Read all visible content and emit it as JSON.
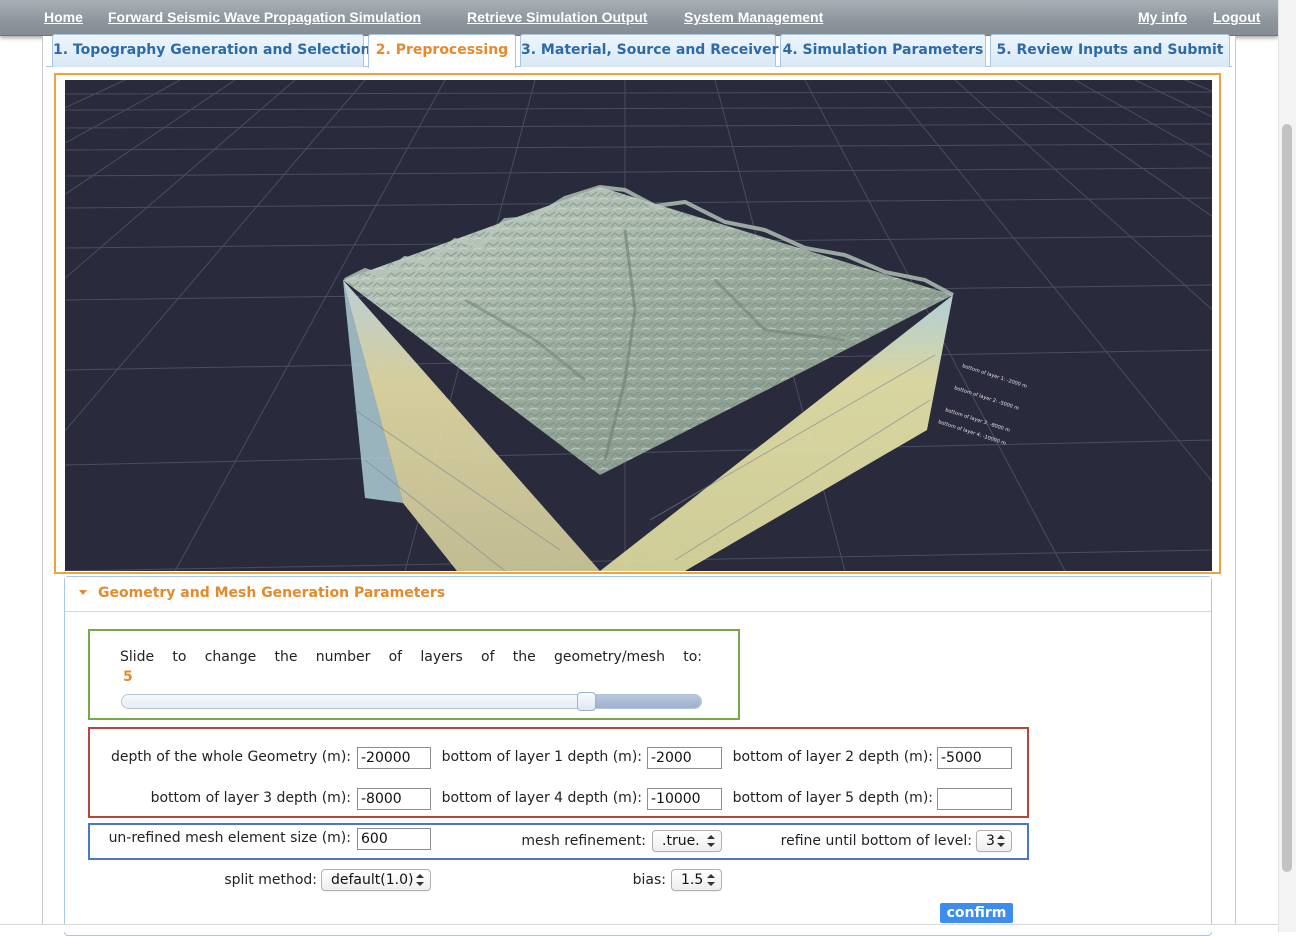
{
  "nav": {
    "home": "Home",
    "forward": "Forward Seismic Wave Propagation Simulation",
    "retrieve": "Retrieve Simulation Output",
    "system": "System Management",
    "myinfo": "My info",
    "logout": "Logout"
  },
  "tabs": [
    {
      "label": "1. Topography Generation and Selection"
    },
    {
      "label": "2. Preprocessing",
      "active": true
    },
    {
      "label": "3. Material, Source and Receiver"
    },
    {
      "label": "4. Simulation Parameters"
    },
    {
      "label": "5. Review Inputs and Submit"
    }
  ],
  "viewer": {
    "background": "#292b3c",
    "annotations": [
      "bottom of layer 1: -2000 m",
      "bottom of layer 2: -5000 m",
      "bottom of layer 3: -8000 m",
      "bottom of layer 4: -10000 m"
    ]
  },
  "accordion": {
    "title": "Geometry and Mesh Generation Parameters"
  },
  "slider": {
    "text": "Slide to change the number of layers of the geometry/mesh to:",
    "value": "5",
    "fraction": 0.8
  },
  "depth": {
    "whole_label": "depth of the whole Geometry (m):",
    "whole_value": "-20000",
    "layer1_label": "bottom of layer 1 depth (m):",
    "layer1_value": "-2000",
    "layer2_label": "bottom of layer 2 depth (m):",
    "layer2_value": "-5000",
    "layer3_label": "bottom of layer 3 depth (m):",
    "layer3_value": "-8000",
    "layer4_label": "bottom of layer 4 depth (m):",
    "layer4_value": "-10000",
    "layer5_label": "bottom of layer 5 depth (m):",
    "layer5_value": ""
  },
  "mesh": {
    "size_label": "un-refined mesh element size (m):",
    "size_value": "600",
    "refine_label": "mesh refinement:",
    "refine_value": ".true.",
    "until_label": "refine until bottom of level:",
    "until_value": "3",
    "split_label": "split method:",
    "split_value": "default(1.0)",
    "bias_label": "bias:",
    "bias_value": "1.5"
  },
  "confirm_label": "confirm",
  "colors": {
    "accent": "#e58a2c",
    "tab_text": "#2c6aa8",
    "viewer_border": "#f0a33c",
    "slider_border": "#79a84a",
    "depth_border": "#b4473c",
    "mesh_border": "#4a77c8",
    "button": "#3d8df0"
  }
}
